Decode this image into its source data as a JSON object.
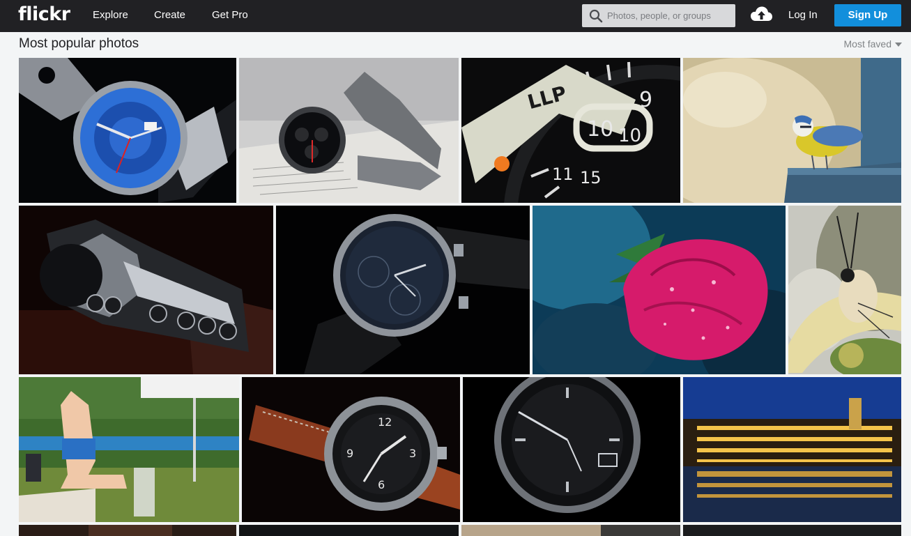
{
  "header": {
    "logo": "flickr",
    "nav": {
      "explore": "Explore",
      "create": "Create",
      "get_pro": "Get Pro"
    },
    "search_placeholder": "Photos, people, or groups",
    "login": "Log In",
    "signup": "Sign Up",
    "icons": {
      "search": "search-icon",
      "upload": "cloud-upload-icon"
    }
  },
  "page": {
    "title": "Most popular photos",
    "sort_label": "Most faved"
  },
  "colors": {
    "topbar": "#212124",
    "signup_button": "#128fdc",
    "page_background": "#f3f5f6"
  },
  "photos": [
    {
      "row": 1,
      "subject": "blue dial wristwatch"
    },
    {
      "row": 1,
      "subject": "chronograph watch on book"
    },
    {
      "row": 1,
      "subject": "camera lens dial close-up"
    },
    {
      "row": 1,
      "subject": "blue tit bird on perch"
    },
    {
      "row": 2,
      "subject": "wristwatch side view on dark background"
    },
    {
      "row": 2,
      "subject": "Hamilton watch on leather strap"
    },
    {
      "row": 2,
      "subject": "pink rose with water droplets"
    },
    {
      "row": 2,
      "subject": "butterfly close-up"
    },
    {
      "row": 3,
      "subject": "athlete high jump"
    },
    {
      "row": 3,
      "subject": "Seiko watch with brown strap"
    },
    {
      "row": 3,
      "subject": "black dial watch macro"
    },
    {
      "row": 3,
      "subject": "illuminated building reflection at night"
    }
  ]
}
